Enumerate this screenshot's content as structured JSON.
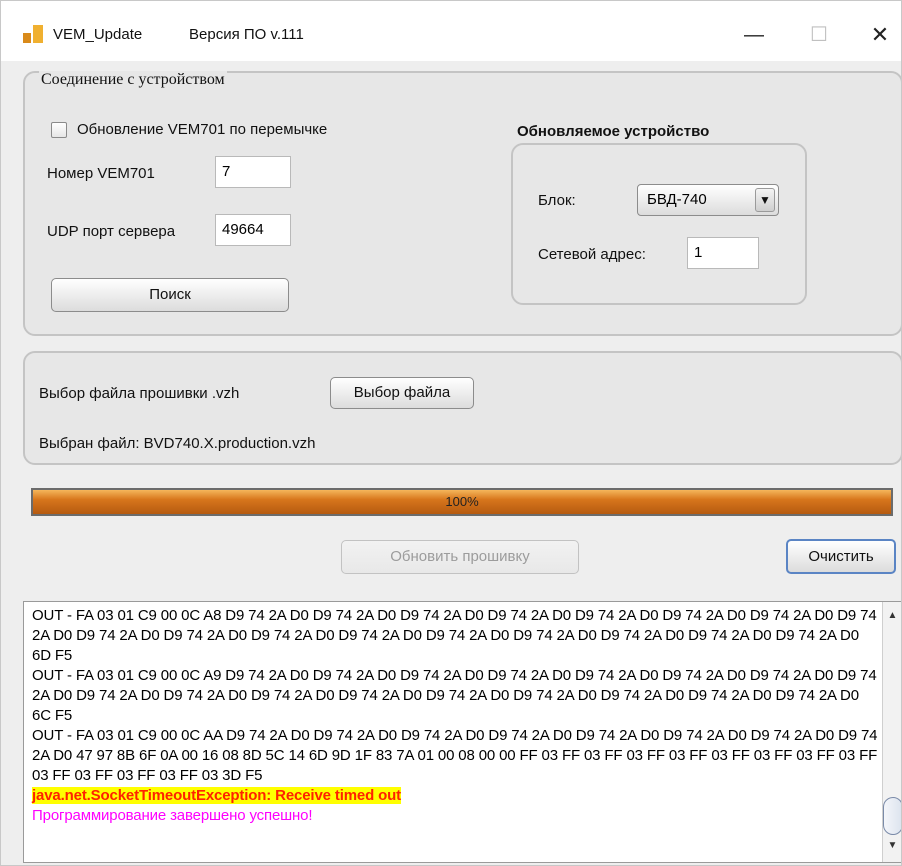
{
  "window": {
    "app_name": "VEM_Update",
    "version_label": "Версия ПО v.111",
    "minimize_glyph": "—",
    "maximize_glyph": "☐",
    "close_glyph": "✕"
  },
  "connection": {
    "legend": "Соединение с устройством",
    "jumper_checkbox_label": "Обновление VEM701 по перемычке",
    "jumper_checked": false,
    "vem_number_label": "Номер VEM701",
    "vem_number_value": "7",
    "udp_port_label": "UDP порт сервера",
    "udp_port_value": "49664",
    "search_button": "Поиск"
  },
  "target_device": {
    "title": "Обновляемое устройство",
    "block_label": "Блок:",
    "block_value": "БВД-740",
    "network_address_label": "Сетевой адрес:",
    "network_address_value": "1"
  },
  "firmware": {
    "select_label": "Выбор файла прошивки .vzh",
    "select_button": "Выбор файла",
    "selected_file_text": "Выбран файл: BVD740.X.production.vzh"
  },
  "progress": {
    "value": 1.0,
    "label": "100%"
  },
  "actions": {
    "update_button": "Обновить прошивку",
    "update_enabled": false,
    "clear_button": "Очистить"
  },
  "log": {
    "lines": [
      "OUT - FA 03 01 C9 00 0C A8 D9 74 2A D0 D9 74 2A D0 D9 74 2A D0 D9 74 2A D0 D9 74 2A D0 D9 74 2A D0 D9 74 2A D0 D9 74 2A D0 D9 74 2A D0 D9 74 2A D0 D9 74 2A D0 D9 74 2A D0 D9 74 2A D0 D9 74 2A D0 D9 74 2A D0 D9 74 2A D0 D9 74 2A D0 6D F5",
      "OUT - FA 03 01 C9 00 0C A9 D9 74 2A D0 D9 74 2A D0 D9 74 2A D0 D9 74 2A D0 D9 74 2A D0 D9 74 2A D0 D9 74 2A D0 D9 74 2A D0 D9 74 2A D0 D9 74 2A D0 D9 74 2A D0 D9 74 2A D0 D9 74 2A D0 D9 74 2A D0 D9 74 2A D0 D9 74 2A D0 D9 74 2A D0 6C F5",
      "OUT - FA 03 01 C9 00 0C AA D9 74 2A D0 D9 74 2A D0 D9 74 2A D0 D9 74 2A D0 D9 74 2A D0 D9 74 2A D0 D9 74 2A D0 D9 74 2A D0 47 97 8B 6F 0A 00 16 08 8D 5C 14 6D 9D 1F 83 7A 01 00 08 00 00 FF 03 FF 03 FF 03 FF 03 FF 03 FF 03 FF 03 FF 03 FF 03 FF 03 FF 03 FF 03 FF 03 3D F5"
    ],
    "error_line": "java.net.SocketTimeoutException: Receive timed out",
    "success_line": "Программирование завершено успешно!"
  },
  "colors": {
    "progress_fill": "#d7761c",
    "error_text": "#ff2200",
    "error_highlight": "#ffff00",
    "success_text": "#ff00ff"
  }
}
